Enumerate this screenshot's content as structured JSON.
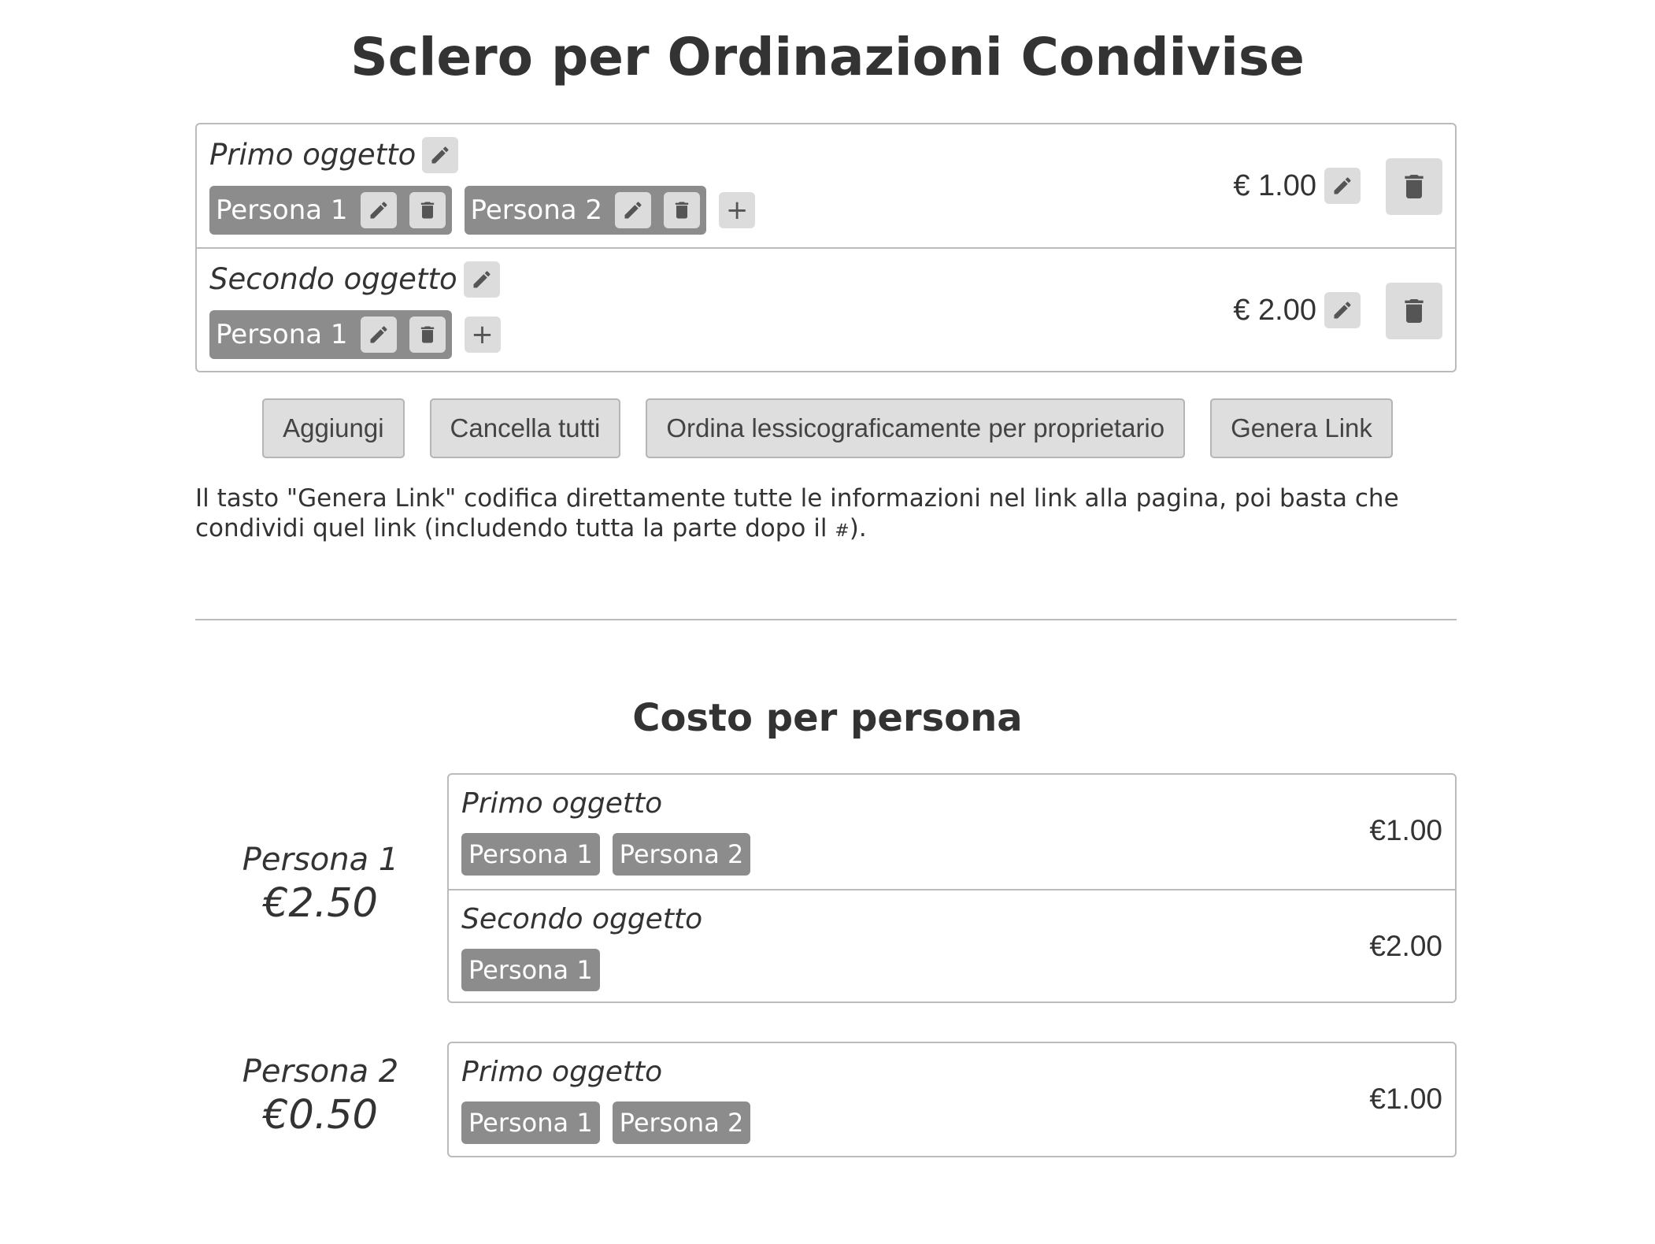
{
  "title": "Sclero per Ordinazioni Condivise",
  "items": [
    {
      "name": "Primo oggetto",
      "price": "€ 1.00",
      "owners": [
        "Persona 1",
        "Persona 2"
      ],
      "add_label": "+"
    },
    {
      "name": "Secondo oggetto",
      "price": "€ 2.00",
      "owners": [
        "Persona 1"
      ],
      "add_label": "+"
    }
  ],
  "actions": {
    "add": "Aggiungi",
    "clear_all": "Cancella tutti",
    "sort": "Ordina lessicograficamente per proprietario",
    "generate_link": "Genera Link"
  },
  "info": {
    "text": "Il tasto \"Genera Link\" codifica direttamente tutte le informazioni nel link alla pagina, poi basta che condividi quel link (includendo tutta la parte dopo il ",
    "hash": "#",
    "end": ")."
  },
  "costs": {
    "title": "Costo per persona",
    "persons": [
      {
        "name": "Persona 1",
        "total": "€2.50",
        "items": [
          {
            "name": "Primo oggetto",
            "owners": [
              "Persona 1",
              "Persona 2"
            ],
            "price": "€1.00"
          },
          {
            "name": "Secondo oggetto",
            "owners": [
              "Persona 1"
            ],
            "price": "€2.00"
          }
        ]
      },
      {
        "name": "Persona 2",
        "total": "€0.50",
        "items": [
          {
            "name": "Primo oggetto",
            "owners": [
              "Persona 1",
              "Persona 2"
            ],
            "price": "€1.00"
          }
        ]
      }
    ]
  },
  "icons": {
    "edit": "pencil-icon",
    "delete": "trash-icon",
    "add": "plus-icon"
  }
}
